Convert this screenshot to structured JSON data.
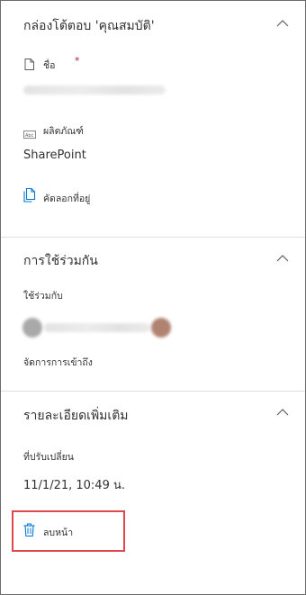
{
  "properties": {
    "title": "กล่องโต้ตอบ 'คุณสมบัติ'",
    "name_label": "ชื่อ",
    "required_mark": "*",
    "product_label": "ผลิตภัณฑ์",
    "product_value": "SharePoint",
    "copy_link_label": "คัดลอกที่อยู่"
  },
  "sharing": {
    "title": "การใช้ร่วมกัน",
    "shared_with_label": "ใช้ร่วมกับ",
    "manage_access_label": "จัดการการเข้าถึง"
  },
  "details": {
    "title": "รายละเอียดเพิ่มเติม",
    "modified_label": "ที่ปรับเปลี่ยน",
    "modified_value": "11/1/21, 10:49 น.",
    "delete_label": "ลบหน้า"
  },
  "colors": {
    "accent": "#0078d4",
    "highlight": "#e0474e",
    "required": "#a4262c",
    "divider": "#e1dfdd"
  },
  "icons": [
    "chevron-up-icon",
    "page-icon",
    "text-field-icon",
    "copy-icon",
    "trash-icon"
  ]
}
